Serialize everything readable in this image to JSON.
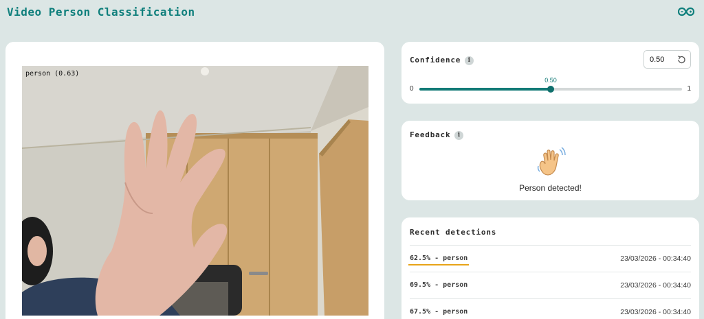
{
  "header": {
    "title": "Video Person Classification",
    "icon": "infinity-icon"
  },
  "video": {
    "overlay_label": "person (0.63)"
  },
  "confidence": {
    "title": "Confidence",
    "input_value": "0.50",
    "min_label": "0",
    "max_label": "1",
    "value": 0.5,
    "value_label": "0.50"
  },
  "feedback": {
    "title": "Feedback",
    "icon": "waving-hand-icon",
    "message": "Person detected!"
  },
  "recent": {
    "title": "Recent detections",
    "rows": [
      {
        "label": "62.5% - person",
        "time": "23/03/2026 - 00:34:40"
      },
      {
        "label": "69.5% - person",
        "time": "23/03/2026 - 00:34:40"
      },
      {
        "label": "67.5% - person",
        "time": "23/03/2026 - 00:34:40"
      }
    ]
  },
  "colors": {
    "accent": "#127a76",
    "highlight": "#e8a317",
    "background": "#dce6e5"
  }
}
